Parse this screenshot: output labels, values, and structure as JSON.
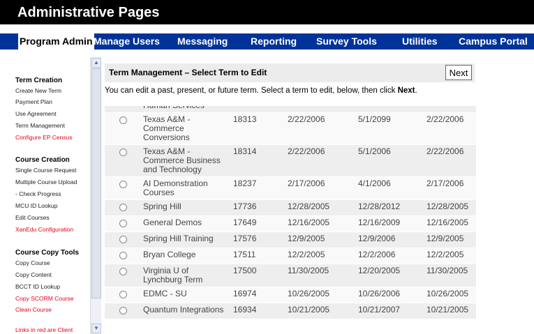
{
  "app_title": "Administrative Pages",
  "nav": [
    {
      "label": "Program Admin",
      "active": true
    },
    {
      "label": "Manage Users"
    },
    {
      "label": "Messaging"
    },
    {
      "label": "Reporting"
    },
    {
      "label": "Survey Tools"
    },
    {
      "label": "Utilities"
    },
    {
      "label": "Campus Portal"
    }
  ],
  "sidebar": {
    "term_creation": {
      "heading": "Term Creation",
      "links": [
        {
          "label": "Create New Term"
        },
        {
          "label": "Payment Plan"
        },
        {
          "label": "Use Agreement"
        },
        {
          "label": "Term Management"
        },
        {
          "label": "Configure EP Census",
          "client": true
        }
      ]
    },
    "course_creation": {
      "heading": "Course Creation",
      "links": [
        {
          "label": "Single Course Request"
        },
        {
          "label": "Multiple Course Upload"
        },
        {
          "label": " - Check Progress"
        },
        {
          "label": "MCU ID Lookup"
        },
        {
          "label": "Edit Courses"
        },
        {
          "label": "XanEdu Configuration",
          "client": true
        }
      ]
    },
    "copy_tools": {
      "heading": "Course Copy Tools",
      "links": [
        {
          "label": "Copy Course"
        },
        {
          "label": "Copy Content"
        },
        {
          "label": "BCCT ID Lookup"
        },
        {
          "label": "Copy SCORM Course",
          "client": true
        },
        {
          "label": "Clean Course",
          "client": true
        }
      ]
    },
    "note": "Links in red are Client"
  },
  "panel": {
    "title": "Term Management – Select Term to Edit",
    "next_label": "Next",
    "instruction_prefix": "You can edit a past, present, or future term. Select a term to edit, below, then click ",
    "instruction_bold": "Next",
    "instruction_suffix": "."
  },
  "terms": [
    {
      "name": "Human Services",
      "id": "",
      "d1": "",
      "d2": "",
      "d3": ""
    },
    {
      "name": "Texas A&M - Commerce Conversions",
      "id": "18313",
      "d1": "2/22/2006",
      "d2": "5/1/2099",
      "d3": "2/22/2006"
    },
    {
      "name": "Texas A&M - Commerce Business and Technology",
      "id": "18314",
      "d1": "2/22/2006",
      "d2": "5/1/2006",
      "d3": "2/22/2006"
    },
    {
      "name": "AI Demonstration Courses",
      "id": "18237",
      "d1": "2/17/2006",
      "d2": "4/1/2006",
      "d3": "2/17/2006"
    },
    {
      "name": "Spring Hill",
      "id": "17736",
      "d1": "12/28/2005",
      "d2": "12/28/2012",
      "d3": "12/28/2005"
    },
    {
      "name": "General Demos",
      "id": "17649",
      "d1": "12/16/2005",
      "d2": "12/16/2009",
      "d3": "12/16/2005"
    },
    {
      "name": "Spring Hill Training",
      "id": "17576",
      "d1": "12/9/2005",
      "d2": "12/9/2006",
      "d3": "12/9/2005"
    },
    {
      "name": "Bryan College",
      "id": "17511",
      "d1": "12/2/2005",
      "d2": "12/2/2006",
      "d3": "12/2/2005"
    },
    {
      "name": "Virginia U of Lynchburg Term",
      "id": "17500",
      "d1": "11/30/2005",
      "d2": "12/20/2005",
      "d3": "11/30/2005"
    },
    {
      "name": "EDMC - SU",
      "id": "16974",
      "d1": "10/26/2005",
      "d2": "10/26/2006",
      "d3": "10/26/2005"
    },
    {
      "name": "Quantum Integrations",
      "id": "16934",
      "d1": "10/21/2005",
      "d2": "10/21/2007",
      "d3": "10/21/2005"
    }
  ],
  "colors": {
    "title_bg": "#000000",
    "nav_bg": "#003399",
    "client_link": "#e8001c",
    "panel_head_bg": "#ececec"
  }
}
